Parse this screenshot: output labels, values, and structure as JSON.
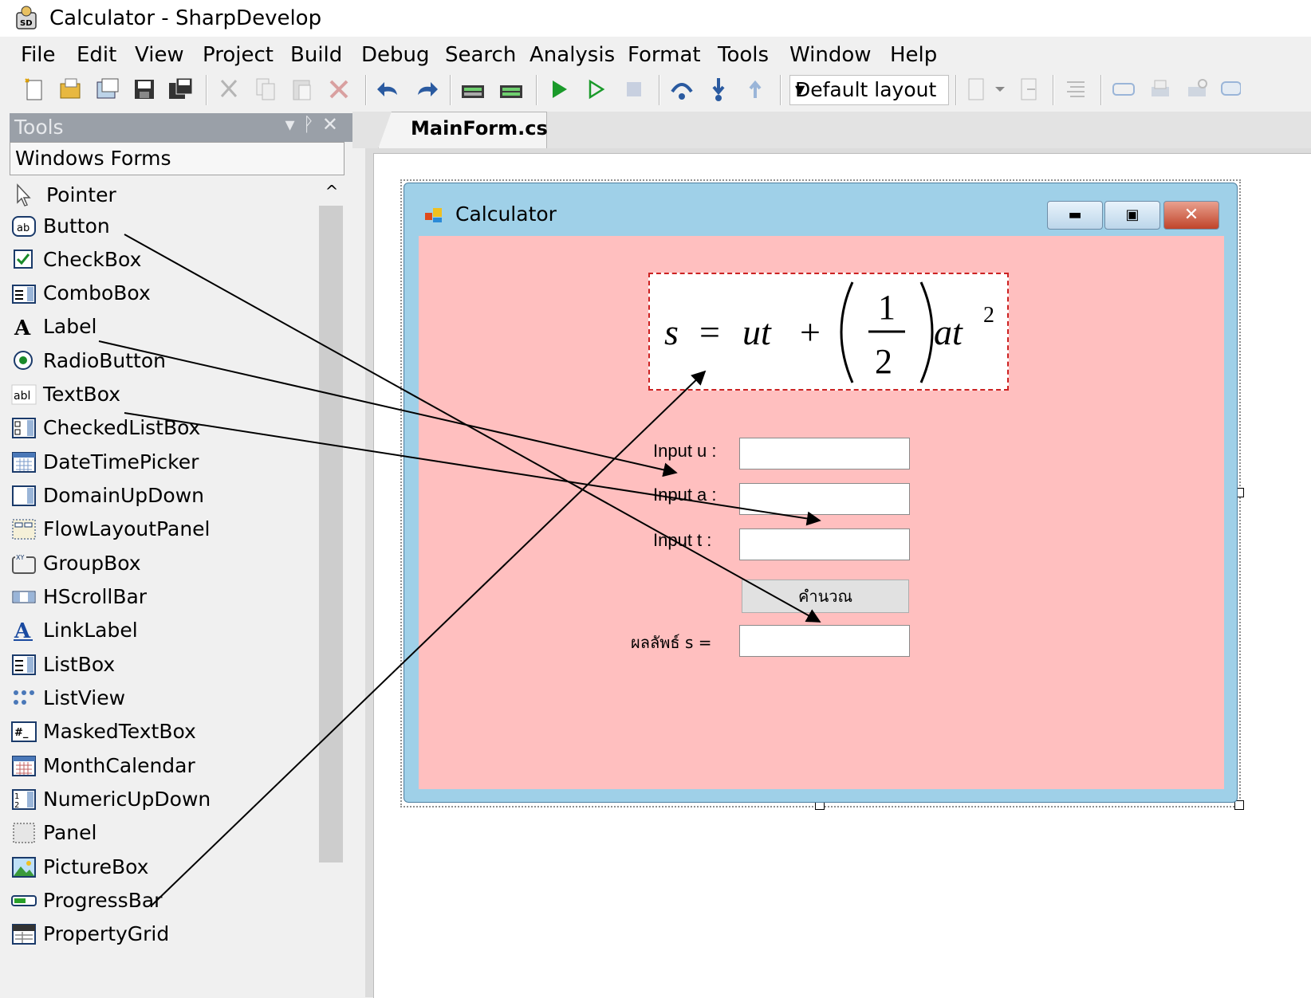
{
  "app": {
    "title": "Calculator - SharpDevelop",
    "icon": "sharpdevelop-icon"
  },
  "menu": [
    "File",
    "Edit",
    "View",
    "Project",
    "Build",
    "Debug",
    "Search",
    "Analysis",
    "Format",
    "Tools",
    "Window",
    "Help"
  ],
  "toolbar": {
    "layout_value": "Default layout"
  },
  "tools": {
    "title": "Tools",
    "category": "Windows Forms",
    "items": [
      {
        "label": "Pointer",
        "icon": "pointer-icon"
      },
      {
        "label": "Button",
        "icon": "button-icon"
      },
      {
        "label": "CheckBox",
        "icon": "checkbox-icon"
      },
      {
        "label": "ComboBox",
        "icon": "combobox-icon"
      },
      {
        "label": "Label",
        "icon": "label-icon"
      },
      {
        "label": "RadioButton",
        "icon": "radiobutton-icon"
      },
      {
        "label": "TextBox",
        "icon": "textbox-icon"
      },
      {
        "label": "CheckedListBox",
        "icon": "checkedlistbox-icon"
      },
      {
        "label": "DateTimePicker",
        "icon": "datetimepicker-icon"
      },
      {
        "label": "DomainUpDown",
        "icon": "domainupdown-icon"
      },
      {
        "label": "FlowLayoutPanel",
        "icon": "flowlayoutpanel-icon"
      },
      {
        "label": "GroupBox",
        "icon": "groupbox-icon"
      },
      {
        "label": "HScrollBar",
        "icon": "hscrollbar-icon"
      },
      {
        "label": "LinkLabel",
        "icon": "linklabel-icon"
      },
      {
        "label": "ListBox",
        "icon": "listbox-icon"
      },
      {
        "label": "ListView",
        "icon": "listview-icon"
      },
      {
        "label": "MaskedTextBox",
        "icon": "maskedtextbox-icon"
      },
      {
        "label": "MonthCalendar",
        "icon": "monthcalendar-icon"
      },
      {
        "label": "NumericUpDown",
        "icon": "numericupdown-icon"
      },
      {
        "label": "Panel",
        "icon": "panel-icon"
      },
      {
        "label": "PictureBox",
        "icon": "picturebox-icon"
      },
      {
        "label": "ProgressBar",
        "icon": "progressbar-icon"
      },
      {
        "label": "PropertyGrid",
        "icon": "propertygrid-icon"
      }
    ]
  },
  "document": {
    "tab_label": "MainForm.cs*"
  },
  "form": {
    "title": "Calculator",
    "label_u": "Input u :",
    "label_a": "Input a :",
    "label_t": "Input t :",
    "button_label": "คำนวณ",
    "label_result": "ผลลัพธ์ s ="
  },
  "colors": {
    "form_client": "#ffbfbf",
    "form_frame": "#9fd0e8",
    "tools_header": "#9aa0a8"
  }
}
